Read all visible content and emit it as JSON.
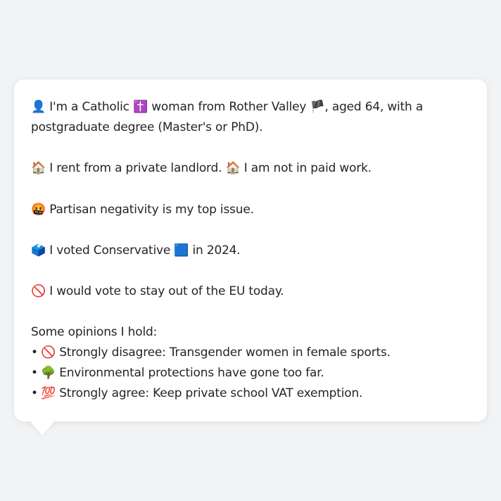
{
  "profile": {
    "intro": {
      "icon": "👤",
      "text_a": "I'm a Catholic",
      "religion_icon": "✝️",
      "text_b": "woman from Rother Valley",
      "flag_icon": "🏴",
      "text_c": ", aged 64, with a postgraduate degree (Master's or PhD)."
    },
    "housing": {
      "icon1": "🏠",
      "text1": "I rent from a private landlord.",
      "icon2": "🏠",
      "text2": "I am not in paid work."
    },
    "issue": {
      "icon": "🤬",
      "text": "Partisan negativity is my top issue."
    },
    "vote": {
      "icon": "🗳️",
      "text_a": "I voted Conservative",
      "party_icon": "🟦",
      "text_b": "in 2024."
    },
    "eu": {
      "icon": "🚫",
      "text": "I would vote to stay out of the EU today."
    },
    "opinions": {
      "heading": "Some opinions I hold:",
      "items": [
        {
          "bullet": "•",
          "icon": "🚫",
          "text": "Strongly disagree: Transgender women in female sports."
        },
        {
          "bullet": "•",
          "icon": "🌳",
          "text": "Environmental protections have gone too far."
        },
        {
          "bullet": "•",
          "icon": "💯",
          "text": "Strongly agree: Keep private school VAT exemption."
        }
      ]
    }
  },
  "colors": {
    "background": "#f1f3f5",
    "card": "#ffffff",
    "text": "#212529"
  }
}
